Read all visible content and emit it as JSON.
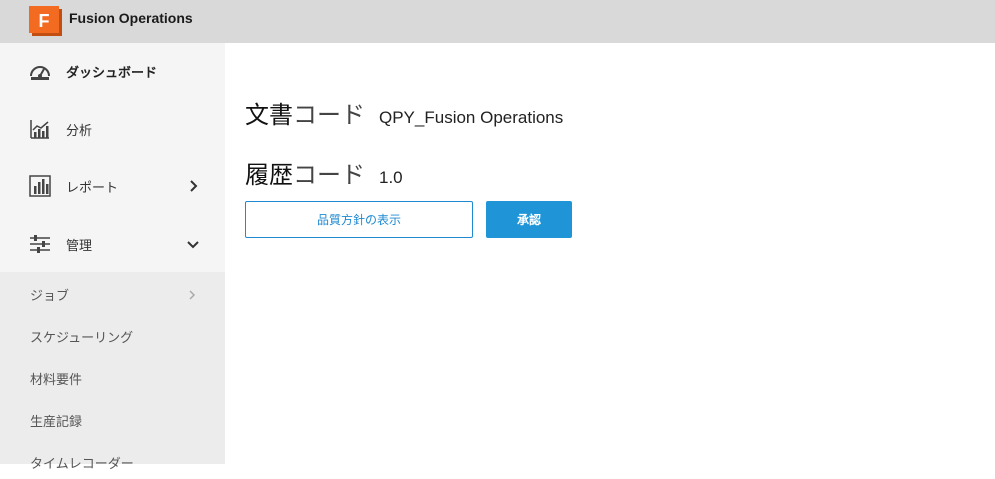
{
  "app": {
    "title": "Fusion Operations",
    "brand_color": "#f26b21"
  },
  "sidebar": {
    "items": [
      {
        "label": "ダッシュボード",
        "icon": "dashboard-icon"
      },
      {
        "label": "分析",
        "icon": "analytics-icon"
      },
      {
        "label": "レポート",
        "icon": "report-icon"
      },
      {
        "label": "管理",
        "icon": "settings-sliders-icon"
      }
    ],
    "sub_items": [
      {
        "label": "ジョブ"
      },
      {
        "label": "スケジューリング"
      },
      {
        "label": "材料要件"
      },
      {
        "label": "生産記録"
      },
      {
        "label": "タイムレコーダー"
      }
    ]
  },
  "main": {
    "doc_code": {
      "strong": "文書",
      "light": "コード",
      "value": "QPY_Fusion Operations"
    },
    "history_code": {
      "strong": "履歴",
      "light": "コード",
      "value": "1.0"
    },
    "show_policy_label": "品質方針の表示",
    "approve_label": "承認",
    "accent_color": "#1f95d8"
  }
}
